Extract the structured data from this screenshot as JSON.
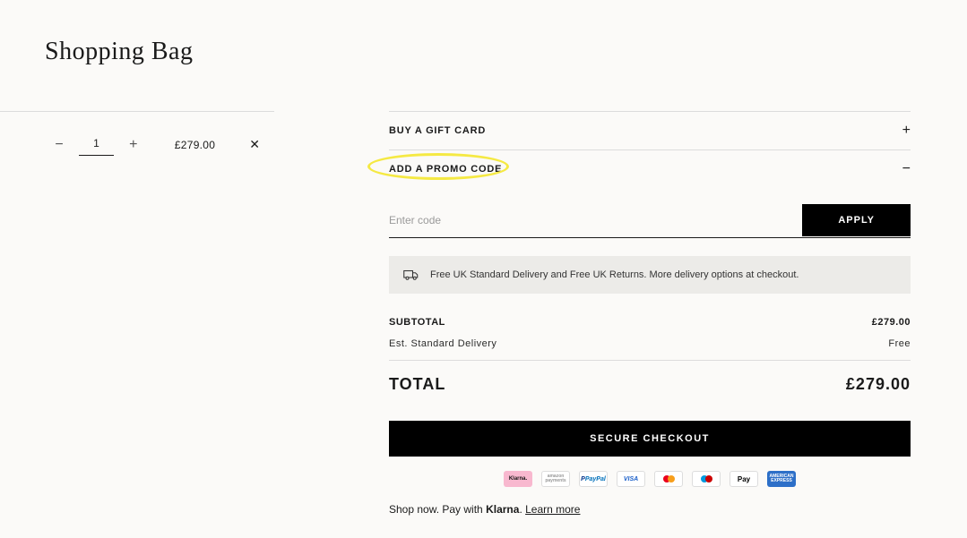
{
  "page": {
    "title": "Shopping Bag"
  },
  "cart": {
    "item": {
      "qty": "1",
      "price": "£279.00"
    }
  },
  "accordion": {
    "gift_card": "BUY A GIFT CARD",
    "promo": "ADD A PROMO CODE"
  },
  "promo": {
    "placeholder": "Enter code",
    "apply": "APPLY"
  },
  "shipping_banner": "Free UK Standard Delivery and Free UK Returns. More delivery options at checkout.",
  "totals": {
    "subtotal_label": "SUBTOTAL",
    "subtotal_value": "£279.00",
    "delivery_label": "Est. Standard Delivery",
    "delivery_value": "Free",
    "total_label": "TOTAL",
    "total_value": "£279.00"
  },
  "checkout": "SECURE CHECKOUT",
  "payments": {
    "klarna": "Klarna.",
    "amazon": "amazon\npayments",
    "paypal": "PayPal",
    "visa": "VISA",
    "applepay": "Pay",
    "amex": "AMERICAN\nEXPRESS"
  },
  "klarna_line": {
    "prefix": "Shop now. Pay with ",
    "brand": "Klarna",
    "suffix": ". ",
    "learn": "Learn more"
  }
}
